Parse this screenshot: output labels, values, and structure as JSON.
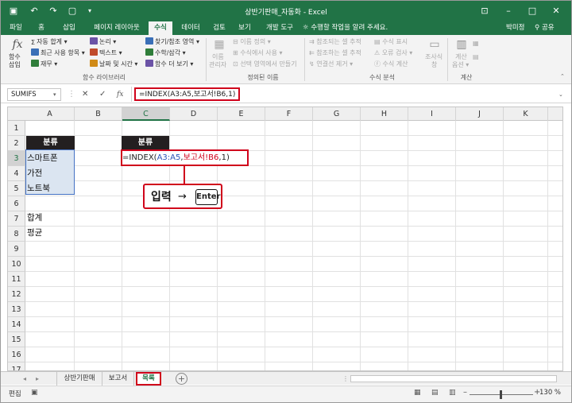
{
  "window": {
    "title": "상반기판매_자동화 - Excel",
    "user": "박미정",
    "share_label": "공유"
  },
  "colors": {
    "excel_green": "#217346",
    "highlight_red": "#d0021b",
    "header_fill": "#231f20",
    "range_blue": "#dbe5f1"
  },
  "tabs": [
    "파일",
    "홈",
    "삽입",
    "페이지 레이아웃",
    "수식",
    "데이터",
    "검토",
    "보기",
    "개발 도구"
  ],
  "active_tab": "수식",
  "tell_me": "수행할 작업을 알려 주세요.",
  "ribbon": {
    "insert_function": {
      "line1": "함수",
      "line2": "삽입"
    },
    "library": {
      "autosum": "자동 합계",
      "recent": "최근 사용 항목",
      "finance": "재무",
      "logical": "논리",
      "text": "텍스트",
      "datetime": "날짜 및 시간",
      "lookup": "찾기/참조 영역",
      "math": "수학/삼각",
      "more": "함수 더 보기",
      "group_label": "함수 라이브러리"
    },
    "names": {
      "manager_line1": "이름",
      "manager_line2": "관리자",
      "define": "이름 정의",
      "use": "수식에서 사용",
      "create": "선택 영역에서 만들기",
      "group_label": "정의된 이름"
    },
    "audit": {
      "precedents": "참조되는 셀 추적",
      "dependents": "참조하는 셀 추적",
      "remove": "연결선 제거",
      "show": "수식 표시",
      "error": "오류 검사",
      "evaluate": "수식 계산",
      "watch_line1": "조사식",
      "watch_line2": "창",
      "group_label": "수식 분석"
    },
    "calc": {
      "options_line1": "계산",
      "options_line2": "옵션",
      "group_label": "계산"
    }
  },
  "formula_bar": {
    "name_box": "SUMIFS",
    "cancel": "✕",
    "enter": "✓",
    "fx": "fx",
    "formula": "=INDEX(A3:A5,보고서!B6,1)"
  },
  "grid": {
    "columns": [
      "A",
      "B",
      "C",
      "D",
      "E",
      "F",
      "G",
      "H",
      "I",
      "J",
      "K"
    ],
    "rows": [
      "1",
      "2",
      "3",
      "4",
      "5",
      "6",
      "7",
      "8",
      "9",
      "10",
      "11",
      "12",
      "13",
      "14",
      "15",
      "16",
      "17"
    ],
    "a2_header": "분류",
    "c2_header": "분류",
    "a3": "스마트폰",
    "a4": "가전",
    "a5": "노트북",
    "a7": "합계",
    "a8": "평균",
    "c3_prefix": "=INDEX(",
    "c3_ref1": "A3:A5",
    "c3_mid": ",",
    "c3_ref2": "보고서!B6",
    "c3_suffix": ",1)"
  },
  "callout": {
    "text": "입력",
    "arrow": "→",
    "key": "Enter"
  },
  "sheets": {
    "tabs": [
      "상반기판매",
      "보고서",
      "목록"
    ],
    "active": "목록",
    "add": "+"
  },
  "status": {
    "mode": "편집",
    "zoom": "130 %"
  }
}
